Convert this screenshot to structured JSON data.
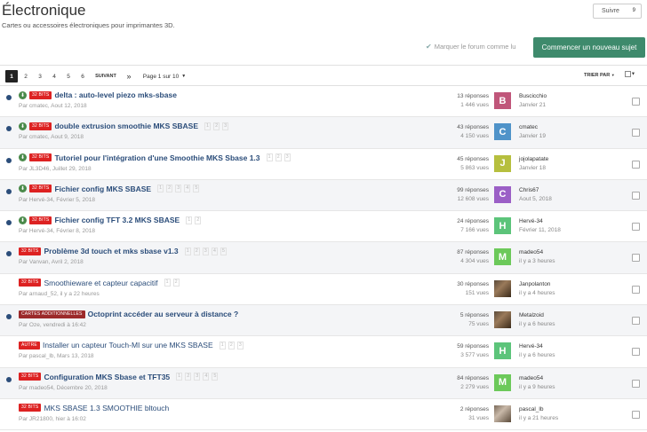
{
  "header": {
    "title": "Électronique",
    "description": "Cartes ou accessoires électroniques pour imprimantes 3D.",
    "follow_label": "Suivre",
    "follow_count": "9",
    "mark_read_label": "Marquer le forum comme lu",
    "new_topic_label": "Commencer un nouveau sujet"
  },
  "pagination": {
    "pages": [
      "1",
      "2",
      "3",
      "4",
      "5",
      "6"
    ],
    "active": "1",
    "next_label": "SUIVANT",
    "last_label": "»",
    "page_of_label": "Page 1 sur 10",
    "sort_label": "TRIER PAR"
  },
  "colors": {
    "accent": "#3e8a6c",
    "title_link": "#2b4d7a",
    "badge_red": "#dd2222"
  },
  "topics": [
    {
      "badge": "32 BITS",
      "title": "delta : auto-level piezo mks-sbase",
      "meta": "Par cmatec, Aout 12, 2018",
      "replies": "13 réponses",
      "views": "1 446 vues",
      "avatar_letter": "B",
      "avatar_color": "#c0567a",
      "last_user": "Buscicchio",
      "last_when": "Janvier 21",
      "unread": true,
      "download": true,
      "pages": []
    },
    {
      "badge": "32 BITS",
      "title": "double extrusion smoothie MKS SBASE",
      "meta": "Par cmatec, Aout 9, 2018",
      "replies": "43 réponses",
      "views": "4 150 vues",
      "avatar_letter": "C",
      "avatar_color": "#4f93c9",
      "last_user": "cmatec",
      "last_when": "Janvier 19",
      "unread": true,
      "download": true,
      "pages": [
        "1",
        "2",
        "3"
      ]
    },
    {
      "badge": "32 BITS",
      "title": "Tutoriel pour l'intégration d'une Smoothie MKS Sbase 1.3",
      "meta": "Par JL3D46, Juillet 29, 2018",
      "replies": "45 réponses",
      "views": "5 863 vues",
      "avatar_letter": "J",
      "avatar_color": "#b6bf3e",
      "last_user": "jojolapatate",
      "last_when": "Janvier 18",
      "unread": true,
      "download": true,
      "pages": [
        "1",
        "2",
        "3"
      ]
    },
    {
      "badge": "32 BITS",
      "title": "Fichier config MKS SBASE",
      "meta": "Par Hervé-34, Février 5, 2018",
      "replies": "99 réponses",
      "views": "12 608 vues",
      "avatar_letter": "C",
      "avatar_color": "#9b5fc6",
      "last_user": "Chris67",
      "last_when": "Aout 5, 2018",
      "unread": true,
      "download": true,
      "pages": [
        "1",
        "2",
        "3",
        "4",
        "5"
      ]
    },
    {
      "badge": "32 BITS",
      "title": "Fichier config TFT 3.2 MKS SBASE",
      "meta": "Par Hervé-34, Février 8, 2018",
      "replies": "24 réponses",
      "views": "7 166 vues",
      "avatar_letter": "H",
      "avatar_color": "#5cc47a",
      "last_user": "Hervé-34",
      "last_when": "Février 11, 2018",
      "unread": true,
      "download": true,
      "pages": [
        "1",
        "2"
      ]
    },
    {
      "badge": "32 BITS",
      "title": "Problème 3d touch et mks sbase v1.3",
      "meta": "Par Vanvan, Avril 2, 2018",
      "replies": "87 réponses",
      "views": "4 304 vues",
      "avatar_letter": "M",
      "avatar_color": "#6cc95a",
      "last_user": "madeo54",
      "last_when": "il y a 3 heures",
      "unread": true,
      "download": false,
      "pages": [
        "1",
        "2",
        "3",
        "4",
        "5"
      ]
    },
    {
      "badge": "32 BITS",
      "title": "Smoothieware et capteur capacitif",
      "meta": "Par arnaud_52, il y a 22 heures",
      "replies": "30 réponses",
      "views": "151 vues",
      "avatar_letter": "",
      "avatar_color": "photo",
      "last_user": "Janpolanton",
      "last_when": "il y a 4 heures",
      "unread": false,
      "download": false,
      "pages": [
        "1",
        "2"
      ]
    },
    {
      "badge": "CARTES ADDITIONNELLES",
      "title": "Octoprint accéder au serveur à distance ?",
      "meta": "Par Oze, vendredi à 16:42",
      "replies": "5 réponses",
      "views": "75 vues",
      "avatar_letter": "",
      "avatar_color": "photo",
      "last_user": "Metalzoid",
      "last_when": "il y a 6 heures",
      "unread": true,
      "download": false,
      "pages": []
    },
    {
      "badge": "AUTRE",
      "title": "Installer un capteur Touch-MI sur une MKS SBASE",
      "meta": "Par pascal_lb, Mars 13, 2018",
      "replies": "59 réponses",
      "views": "3 577 vues",
      "avatar_letter": "H",
      "avatar_color": "#5cc47a",
      "last_user": "Hervé-34",
      "last_when": "il y a 6 heures",
      "unread": false,
      "download": false,
      "pages": [
        "1",
        "2",
        "3"
      ]
    },
    {
      "badge": "32 BITS",
      "title": "Configuration MKS Sbase et TFT35",
      "meta": "Par madeo54, Décembre 20, 2018",
      "replies": "84 réponses",
      "views": "2 279 vues",
      "avatar_letter": "M",
      "avatar_color": "#6cc95a",
      "last_user": "madeo54",
      "last_when": "il y a 9 heures",
      "unread": true,
      "download": false,
      "pages": [
        "1",
        "2",
        "3",
        "4",
        "5"
      ]
    },
    {
      "badge": "32 BITS",
      "title": "MKS SBASE 1.3 SMOOTHIE bltouch",
      "meta": "Par JR21800, hier à 16:02",
      "replies": "2 réponses",
      "views": "31 vues",
      "avatar_letter": "",
      "avatar_color": "photo2",
      "last_user": "pascal_lb",
      "last_when": "il y a 21 heures",
      "unread": false,
      "download": false,
      "pages": []
    }
  ]
}
